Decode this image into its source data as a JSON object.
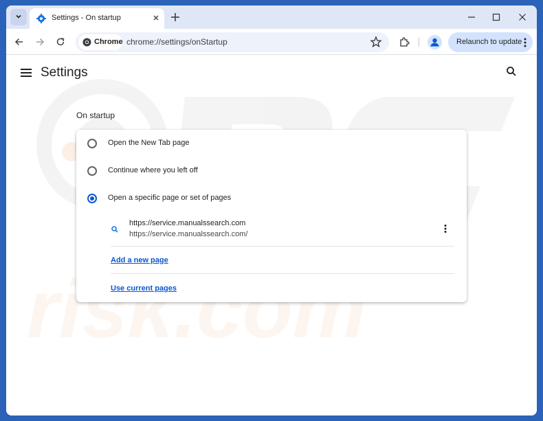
{
  "tab": {
    "title": "Settings - On startup"
  },
  "toolbar": {
    "chrome_chip": "Chrome",
    "url": "chrome://settings/onStartup",
    "relaunch_label": "Relaunch to update"
  },
  "page": {
    "title": "Settings",
    "section_title": "On startup",
    "options": [
      {
        "label": "Open the New Tab page",
        "selected": false
      },
      {
        "label": "Continue where you left off",
        "selected": false
      },
      {
        "label": "Open a specific page or set of pages",
        "selected": true
      }
    ],
    "startup_page": {
      "title": "https://service.manualssearch.com",
      "url": "https://service.manualssearch.com/"
    },
    "add_new_page": "Add a new page",
    "use_current_pages": "Use current pages"
  },
  "colors": {
    "accent": "#0b57d0",
    "frame": "#2a63b8",
    "tabstrip": "#dfe6f5"
  },
  "icons": [
    "tab-search-icon",
    "settings-favicon",
    "close-icon",
    "plus-icon",
    "minimize-icon",
    "maximize-icon",
    "back-icon",
    "forward-icon",
    "reload-icon",
    "chrome-icon",
    "star-icon",
    "extensions-icon",
    "profile-icon",
    "more-icon",
    "menu-icon",
    "search-icon"
  ]
}
